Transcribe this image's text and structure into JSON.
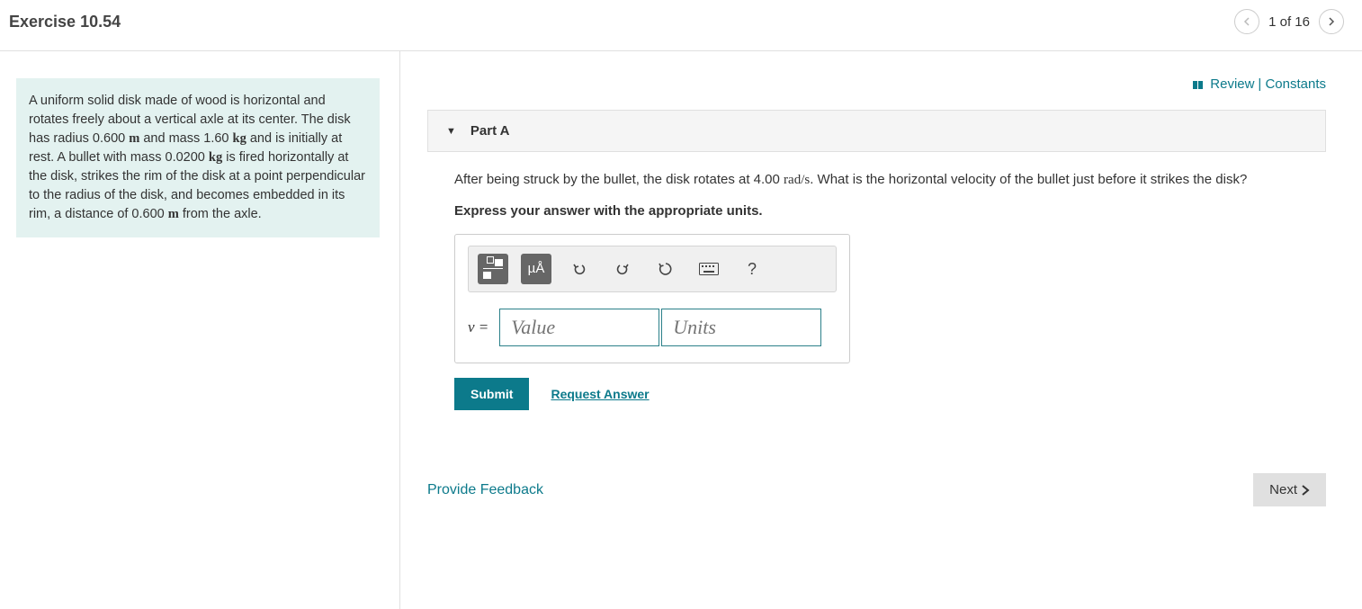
{
  "header": {
    "title": "Exercise 10.54",
    "nav_count": "1 of 16"
  },
  "problem": {
    "text_html": "A uniform solid disk made of wood is horizontal and rotates freely about a vertical axle at its center. The disk has radius 0.600 <b class='serif-unit'>m</b> and mass 1.60 <b class='serif-unit'>kg</b> and is initially at rest. A bullet with mass 0.0200 <b class='serif-unit'>kg</b> is fired horizontally at the disk, strikes the rim of the disk at a point perpendicular to the radius of the disk, and becomes embedded in its rim, a distance of 0.600 <b class='serif-unit'>m</b> from the axle."
  },
  "links": {
    "review": "Review",
    "constants": "Constants",
    "request_answer": "Request Answer",
    "feedback": "Provide Feedback"
  },
  "part": {
    "label": "Part A",
    "question_html": "After being struck by the bullet, the disk rotates at 4.00 <span class='serif-unit'>rad/s</span>. What is the horizontal velocity of the bullet just before it strikes the disk?",
    "express": "Express your answer with the appropriate units.",
    "variable": "v =",
    "value_placeholder": "Value",
    "units_placeholder": "Units",
    "toolbar": {
      "mu_a": "µÅ",
      "undo": "↶",
      "redo": "↷",
      "reset": "↺",
      "help": "?"
    }
  },
  "buttons": {
    "submit": "Submit",
    "next": "Next"
  }
}
